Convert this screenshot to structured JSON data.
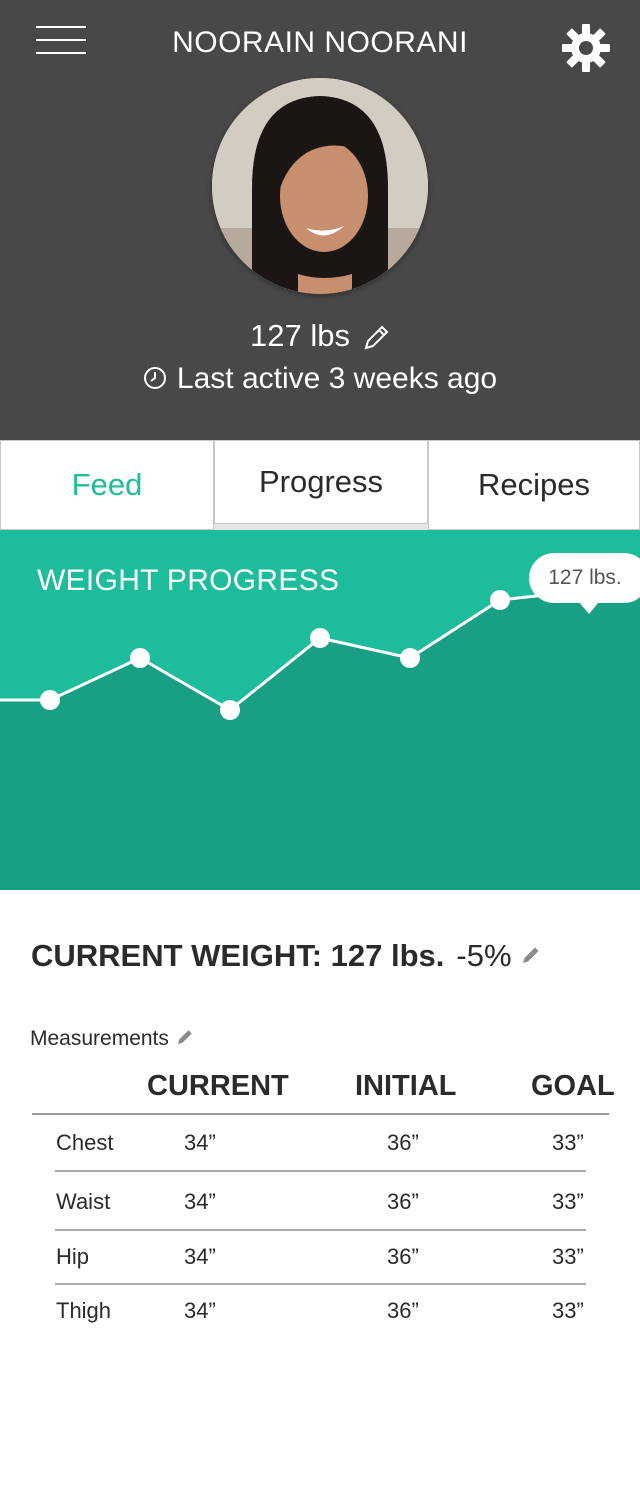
{
  "header": {
    "name": "NOORAIN NOORANI",
    "weight": "127 lbs",
    "last_active": "Last active 3 weeks ago",
    "menu_icon": "hamburger-menu-icon",
    "settings_icon": "gear-icon",
    "background": "#484848"
  },
  "tabs": [
    {
      "label": "Feed",
      "active": true
    },
    {
      "label": "Progress",
      "active": false
    },
    {
      "label": "Recipes",
      "active": false
    }
  ],
  "accent_color": "#1fbd9b",
  "weight_progress": {
    "title": "WEIGHT PROGRESS",
    "tooltip": "127 lbs."
  },
  "chart_data": {
    "type": "area",
    "title": "WEIGHT PROGRESS",
    "xlabel": "",
    "ylabel": "",
    "x": [
      1,
      2,
      3,
      4,
      5,
      6,
      7
    ],
    "values": [
      121.5,
      123.6,
      121.0,
      124.6,
      123.6,
      126.5,
      127
    ],
    "ylim": [
      112,
      130
    ],
    "highlight": {
      "index": 6,
      "label": "127 lbs."
    },
    "grid": false,
    "line_color": "#ffffff",
    "fill_color": "#189f84",
    "background": "#1dbc9a"
  },
  "current_weight": {
    "label": "CURRENT WEIGHT: 127 lbs.",
    "change": "-5%"
  },
  "measurements": {
    "label": "Measurements",
    "columns": [
      "CURRENT",
      "INITIAL",
      "GOAL"
    ],
    "rows": [
      {
        "name": "Chest",
        "current": "34”",
        "initial": "36”",
        "goal": "33”"
      },
      {
        "name": "Waist",
        "current": "34”",
        "initial": "36”",
        "goal": "33”"
      },
      {
        "name": "Hip",
        "current": "34”",
        "initial": "36”",
        "goal": "33”"
      },
      {
        "name": "Thigh",
        "current": "34”",
        "initial": "36”",
        "goal": "33”"
      }
    ]
  }
}
